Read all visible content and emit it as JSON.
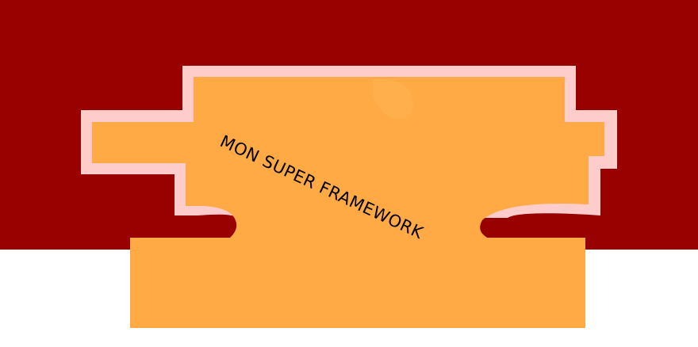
{
  "logo": {
    "text": "MON SUPER FRAMEWORK"
  },
  "colors": {
    "banner": "#990000",
    "outline": "#ffcccc",
    "body": "#ffaa44",
    "text": "#000000",
    "background": "#ffffff"
  }
}
